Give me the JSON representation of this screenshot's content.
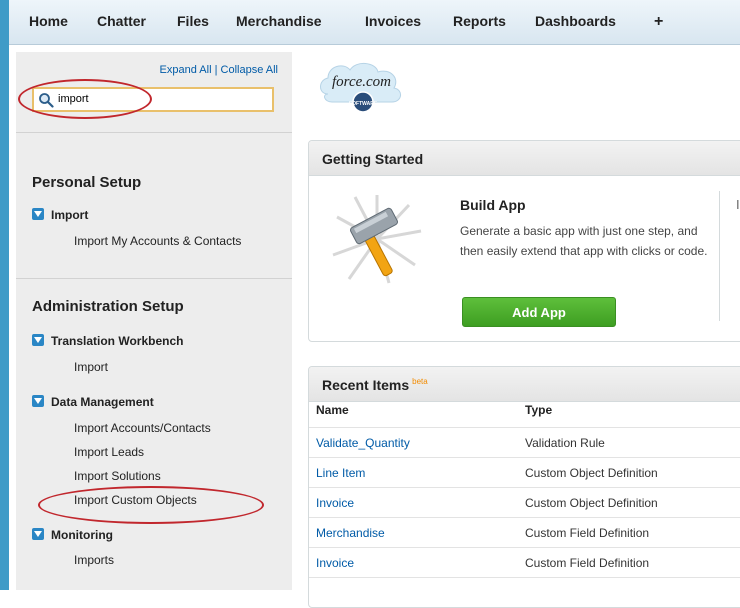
{
  "tabs": [
    "Home",
    "Chatter",
    "Files",
    "Merchandise",
    "Invoices",
    "Reports",
    "Dashboards"
  ],
  "plus_tab": "+",
  "sidebar": {
    "expand_all": "Expand All",
    "separator": " | ",
    "collapse_all": "Collapse All",
    "search_value": "import",
    "personal_setup": {
      "heading": "Personal Setup",
      "sections": [
        {
          "label": "Import",
          "items": [
            "Import My Accounts & Contacts"
          ]
        }
      ]
    },
    "administration_setup": {
      "heading": "Administration Setup",
      "sections": [
        {
          "label": "Translation Workbench",
          "items": [
            "Import"
          ]
        },
        {
          "label": "Data Management",
          "items": [
            "Import Accounts/Contacts",
            "Import Leads",
            "Import Solutions",
            "Import Custom Objects"
          ]
        },
        {
          "label": "Monitoring",
          "items": [
            "Imports"
          ]
        }
      ]
    }
  },
  "logo": {
    "text": "force.com",
    "badge": "SOFTWARE"
  },
  "getting_started": {
    "title": "Getting Started",
    "build_app_title": "Build App",
    "build_app_description": "Generate a basic app with just one step, and then easily extend that app with clicks or code.",
    "add_app_button": "Add App",
    "next_card_partial": "I"
  },
  "recent_items": {
    "title": "Recent Items",
    "beta": "beta",
    "columns": [
      "Name",
      "Type"
    ],
    "rows": [
      {
        "name": "Validate_Quantity",
        "type": "Validation Rule"
      },
      {
        "name": "Line Item",
        "type": "Custom Object Definition"
      },
      {
        "name": "Invoice",
        "type": "Custom Object Definition"
      },
      {
        "name": "Merchandise",
        "type": "Custom Field Definition"
      },
      {
        "name": "Invoice",
        "type": "Custom Field Definition"
      }
    ]
  },
  "colors": {
    "accent_blue": "#3f9bc7",
    "link": "#015ba7",
    "button_green": "#4caf2e",
    "highlight_oval": "#c1272d",
    "search_border": "#e9c06b"
  }
}
